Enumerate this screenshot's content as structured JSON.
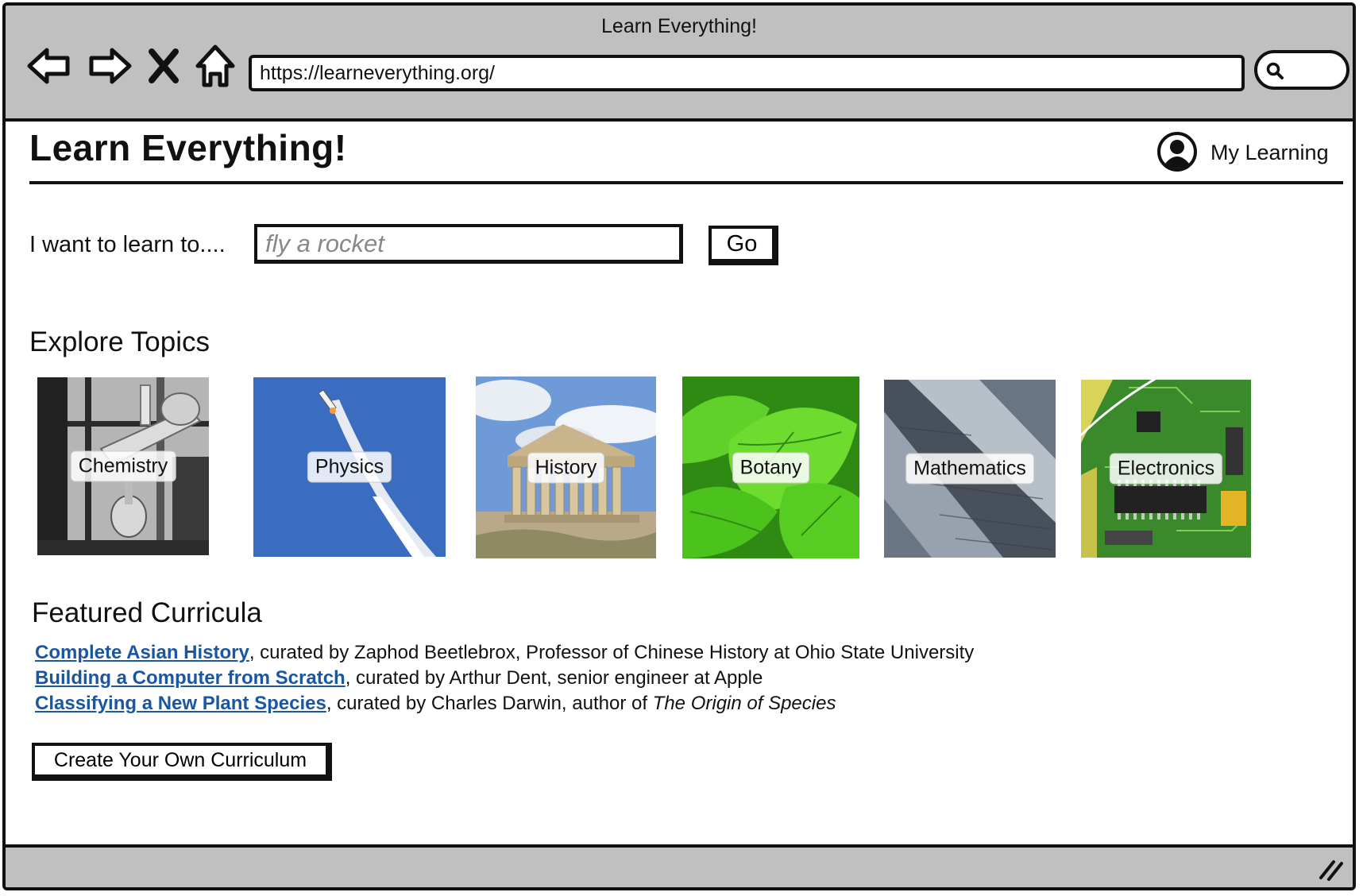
{
  "window": {
    "title": "Learn Everything!"
  },
  "browser": {
    "url": "https://learneverything.org/",
    "nav_icons": [
      "back-arrow-icon",
      "forward-arrow-icon",
      "close-x-icon",
      "home-icon"
    ],
    "search_icon": "search-icon"
  },
  "header": {
    "title": "Learn Everything!",
    "account_label": "My Learning",
    "account_icon": "user-avatar-icon"
  },
  "search": {
    "label": "I want to learn to....",
    "placeholder": "fly a rocket",
    "button_label": "Go"
  },
  "explore": {
    "title": "Explore Topics",
    "topics": [
      {
        "label": "Chemistry"
      },
      {
        "label": "Physics"
      },
      {
        "label": "History"
      },
      {
        "label": "Botany"
      },
      {
        "label": "Mathematics"
      },
      {
        "label": "Electronics"
      }
    ]
  },
  "featured": {
    "title": "Featured Curricula",
    "items": [
      {
        "link": "Complete Asian History",
        "pre": ", curated by Zaphod Beetlebrox, Professor of Chinese History at Ohio State University",
        "book": ""
      },
      {
        "link": "Building a Computer from Scratch",
        "pre": ", curated by Arthur Dent, senior engineer at Apple",
        "book": ""
      },
      {
        "link": "Classifying a New Plant Species",
        "pre": ", curated by Charles Darwin, author of ",
        "book": "The Origin of Species"
      }
    ],
    "create_label": "Create Your Own Curriculum"
  },
  "colors": {
    "chrome": "#c0c0c0",
    "link": "#1b57a0",
    "physics_sky": "#3a6cc0",
    "botany_leaf": "#4cc21c",
    "pcb_green": "#3a8a2c"
  }
}
